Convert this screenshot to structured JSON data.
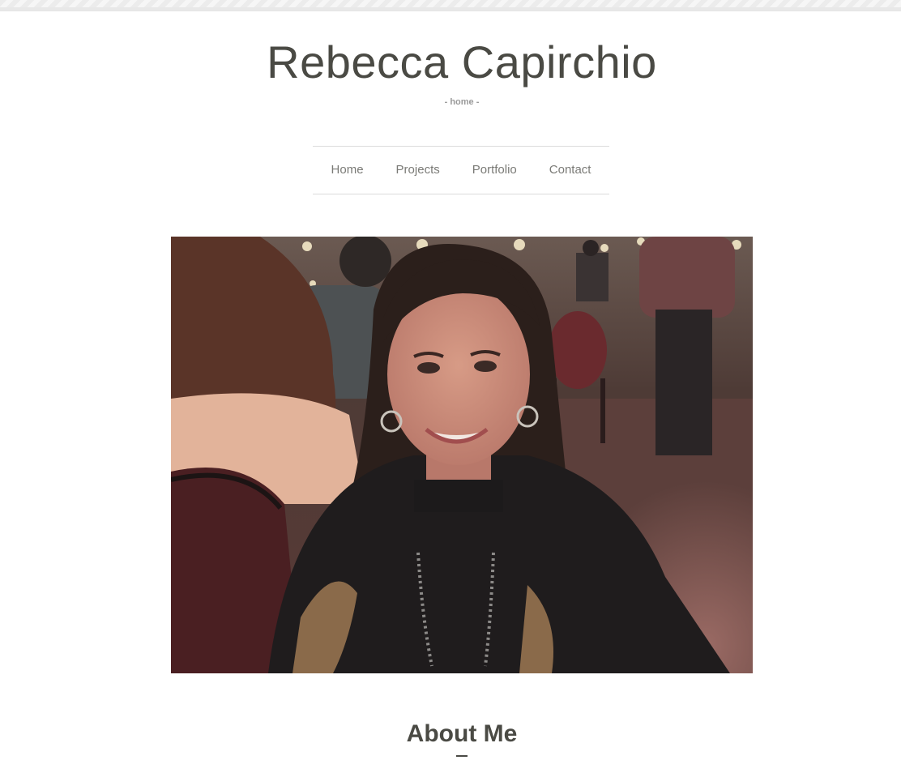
{
  "site": {
    "title": "Rebecca Capirchio",
    "subtitle": "- home -"
  },
  "nav": {
    "items": [
      {
        "label": "Home"
      },
      {
        "label": "Projects"
      },
      {
        "label": "Portfolio"
      },
      {
        "label": "Contact"
      }
    ]
  },
  "hero": {
    "image": "portrait-photo"
  },
  "about": {
    "heading": "About Me"
  },
  "colors": {
    "text": "#4a4a44",
    "nav_text": "#7a7a76",
    "subtitle": "#9a9a9a",
    "divider": "#dcdcdc"
  }
}
